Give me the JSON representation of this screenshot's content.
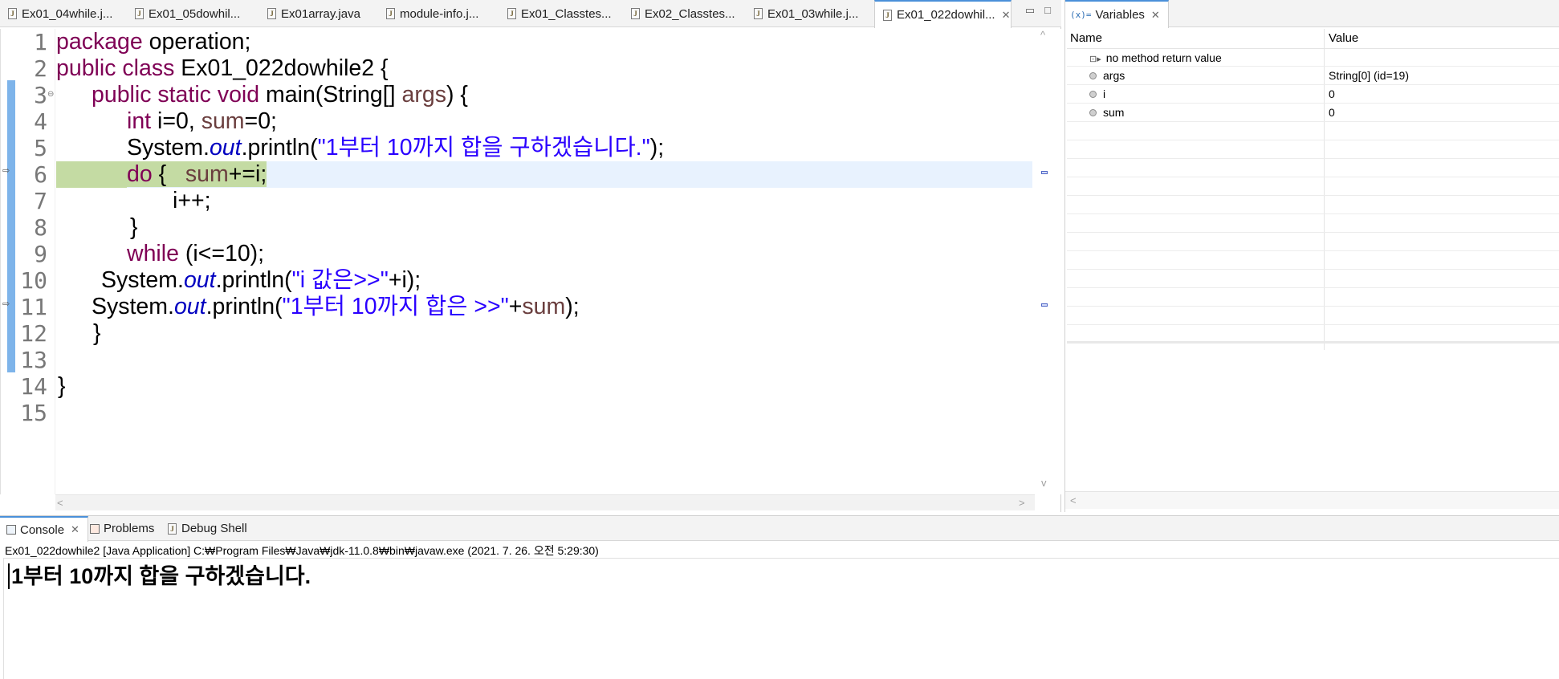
{
  "editor": {
    "tabs": [
      {
        "label": "Ex01_04while.j...",
        "active": false
      },
      {
        "label": "Ex01_05dowhil...",
        "active": false
      },
      {
        "label": "Ex01array.java",
        "active": false
      },
      {
        "label": "module-info.j...",
        "active": false
      },
      {
        "label": "Ex01_Classtes...",
        "active": false
      },
      {
        "label": "Ex02_Classtes...",
        "active": false
      },
      {
        "label": "Ex01_03while.j...",
        "active": false
      },
      {
        "label": "Ex01_022dowhil...",
        "active": true
      }
    ],
    "close_glyph": "✕",
    "minimize_glyph": "▭",
    "maximize_glyph": "□",
    "line_numbers": [
      "1",
      "2",
      "3",
      "4",
      "5",
      "6",
      "7",
      "8",
      "9",
      "10",
      "11",
      "12",
      "13",
      "14",
      "15"
    ],
    "current_line": 6,
    "code": {
      "l1_kw": "package",
      "l1_rest": " operation;",
      "l2_kw": "public class",
      "l2_rest": " Ex01_022dowhile2 {",
      "l3_kw": "public static void",
      "l3_mid": " main(String[] ",
      "l3_var": "args",
      "l3_end": ") {",
      "l4_kw": "int",
      "l4_a": " i=0, ",
      "l4_var": "sum",
      "l4_b": "=0;",
      "l5_a": "System.",
      "l5_field": "out",
      "l5_b": ".println(",
      "l5_str": "\"1부터 10까지 합을 구하겠습니다.\"",
      "l5_c": ");",
      "l6_kw": "do",
      "l6_a": " {   ",
      "l6_var": "sum",
      "l6_b": "+=",
      "l6_c": "i;",
      "l7": "i++;",
      "l8": "}",
      "l9_kw": "while",
      "l9_rest": " (i<=10);",
      "l10_a": "System.",
      "l10_field": "out",
      "l10_b": ".println(",
      "l10_str": "\"i 값은>>\"",
      "l10_c": "+i);",
      "l11_a": "System.",
      "l11_field": "out",
      "l11_b": ".println(",
      "l11_str": "\"1부터 10까지 합은 >>\"",
      "l11_c": "+",
      "l11_var": "sum",
      "l11_d": ");",
      "l12": "}",
      "l14": "}"
    },
    "fold_glyph": "⊖",
    "scroll_left": "<",
    "scroll_right": ">",
    "scroll_up": "^",
    "scroll_down": "v"
  },
  "variables": {
    "tab_icon": "(x)=",
    "tab_label": "Variables",
    "columns": {
      "name": "Name",
      "value": "Value"
    },
    "rows": [
      {
        "name": "no method return value",
        "value": "",
        "icon": "return-icon"
      },
      {
        "name": "args",
        "value": "String[0]  (id=19)",
        "icon": "local-variable-icon"
      },
      {
        "name": "i",
        "value": "0",
        "icon": "local-variable-icon"
      },
      {
        "name": "sum",
        "value": "0",
        "icon": "local-variable-icon"
      }
    ],
    "return_glyph": "⊡▸",
    "scroll_left": "<"
  },
  "console": {
    "tabs": [
      {
        "label": "Console",
        "active": true
      },
      {
        "label": "Problems",
        "active": false
      },
      {
        "label": "Debug Shell",
        "active": false
      }
    ],
    "close_glyph": "✕",
    "description": "Ex01_022dowhile2 [Java Application] C:₩Program Files₩Java₩jdk-11.0.8₩bin₩javaw.exe  (2021. 7. 26. 오전 5:29:30)",
    "output": "1부터 10까지 합을 구하겠습니다."
  },
  "colors": {
    "keyword": "#7f0055",
    "string": "#2a00ff",
    "field": "#0000c0",
    "local_var": "#6a3e3e",
    "current_line_bg": "#e8f2fe",
    "highlight_bg": "#c4dba3",
    "active_tab_accent": "#4a90d9"
  }
}
